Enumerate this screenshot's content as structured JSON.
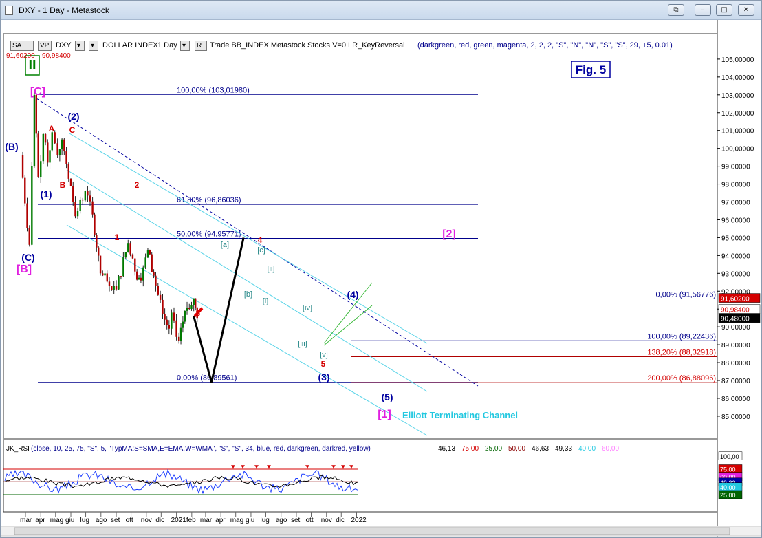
{
  "window": {
    "title": "DXY - 1 Day - Metastock",
    "buttons": {
      "restore_alt": "⧉",
      "minimize": "–",
      "maximize": "□",
      "close": "✕"
    }
  },
  "toolbar": {
    "sa_label": "SA",
    "vp_label": "VP",
    "symbol": "DXY",
    "symbol_name": "DOLLAR INDEX",
    "period": "1 Day",
    "r_label": "R",
    "expert_text": "Trade BB_INDEX Metastock Stocks V=0 LR_KeyReversal",
    "expert_params": "(darkgreen, red, green, magenta, 2, 2, 2, \"S\", \"N\", \"N\", \"S\", \"S\", 29, +5, 0.01)",
    "price_a": "91,60200",
    "price_b": "90,98400"
  },
  "colors": {
    "price_up": "#007a00",
    "price_down": "#b00000",
    "fib": "#00008b",
    "channel": "#5ad4e8",
    "red_label": "#d40000",
    "navy_label": "#0000a0",
    "magenta": "#e020e0",
    "teal": "#2a8a8a",
    "cyan_text": "#22c8e0",
    "green": "#008000"
  },
  "fig_label": "Fig. 5",
  "terminating_label": "Elliott Terminating Channel",
  "wave_labels": [
    {
      "text": "II",
      "kind": "green-box"
    },
    {
      "text": "[C]",
      "kind": "magenta"
    },
    {
      "text": "(B)",
      "kind": "navy"
    },
    {
      "text": "(1)",
      "kind": "navy"
    },
    {
      "text": "(2)",
      "kind": "navy"
    },
    {
      "text": "A",
      "kind": "red"
    },
    {
      "text": "B",
      "kind": "red"
    },
    {
      "text": "C",
      "kind": "red"
    },
    {
      "text": "(C)",
      "kind": "navy"
    },
    {
      "text": "[B]",
      "kind": "magenta"
    },
    {
      "text": "2",
      "kind": "red"
    },
    {
      "text": "1",
      "kind": "red"
    },
    {
      "text": "3",
      "kind": "red"
    },
    {
      "text": "4",
      "kind": "red"
    },
    {
      "text": "[a]",
      "kind": "teal"
    },
    {
      "text": "[b]",
      "kind": "teal"
    },
    {
      "text": "[c]",
      "kind": "teal"
    },
    {
      "text": "[i]",
      "kind": "teal"
    },
    {
      "text": "[ii]",
      "kind": "teal"
    },
    {
      "text": "[iii]",
      "kind": "teal"
    },
    {
      "text": "[iv]",
      "kind": "teal"
    },
    {
      "text": "[v]",
      "kind": "teal"
    },
    {
      "text": "5",
      "kind": "red"
    },
    {
      "text": "(3)",
      "kind": "navy"
    },
    {
      "text": "(4)",
      "kind": "navy"
    },
    {
      "text": "(5)",
      "kind": "navy"
    },
    {
      "text": "[1]",
      "kind": "magenta"
    },
    {
      "text": "[2]",
      "kind": "magenta"
    }
  ],
  "fib_levels": [
    {
      "label": "100,00% (103,01980)",
      "value": 103.0198,
      "side": "left"
    },
    {
      "label": "61,80% (96,86036)",
      "value": 96.86036,
      "side": "left"
    },
    {
      "label": "50,00% (94,95771)",
      "value": 94.95771,
      "side": "left"
    },
    {
      "label": "0,00% (86,89561)",
      "value": 86.89561,
      "side": "left"
    },
    {
      "label": "0,00% (91,56776)",
      "value": 91.56776,
      "side": "right"
    },
    {
      "label": "100,00% (89,22436)",
      "value": 89.22436,
      "side": "right"
    },
    {
      "label": "138,20% (88,32918)",
      "value": 88.32918,
      "side": "right"
    },
    {
      "label": "200,00% (86,88096)",
      "value": 86.88096,
      "side": "right"
    }
  ],
  "price_tags": [
    {
      "text": "91,60200",
      "value": 91.602,
      "bg": "#d40000",
      "fg": "#ffffff"
    },
    {
      "text": "90,98400",
      "value": 90.984,
      "bg": "#ffffff",
      "fg": "#d40000"
    },
    {
      "text": "90,48000",
      "value": 90.48,
      "bg": "#000000",
      "fg": "#ffffff"
    }
  ],
  "chart_data": {
    "type": "candlestick",
    "symbol": "DXY",
    "x_ticks": [
      "mar",
      "apr",
      "mag",
      "giu",
      "lug",
      "ago",
      "set",
      "ott",
      "nov",
      "dic",
      "2021",
      "feb",
      "mar",
      "apr",
      "mag",
      "giu",
      "lug",
      "ago",
      "set",
      "ott",
      "nov",
      "dic",
      "2022"
    ],
    "y_ticks": [
      "105,00000",
      "104,00000",
      "103,00000",
      "102,00000",
      "101,00000",
      "100,00000",
      "99,00000",
      "98,00000",
      "97,00000",
      "96,00000",
      "95,00000",
      "94,00000",
      "93,00000",
      "92,00000",
      "91,00000",
      "90,00000",
      "89,00000",
      "88,00000",
      "87,00000",
      "86,00000",
      "85,00000"
    ],
    "ylim": [
      84.5,
      106.0
    ],
    "price_path": [
      {
        "date": "2020-02-20",
        "close": 99.6
      },
      {
        "date": "2020-03-09",
        "close": 94.6
      },
      {
        "date": "2020-03-19",
        "close": 103.0
      },
      {
        "date": "2020-03-27",
        "close": 98.4
      },
      {
        "date": "2020-04-06",
        "close": 100.8
      },
      {
        "date": "2020-04-15",
        "close": 99.2
      },
      {
        "date": "2020-04-24",
        "close": 100.9
      },
      {
        "date": "2020-05-05",
        "close": 99.6
      },
      {
        "date": "2020-05-14",
        "close": 100.5
      },
      {
        "date": "2020-06-01",
        "close": 97.9
      },
      {
        "date": "2020-06-10",
        "close": 96.2
      },
      {
        "date": "2020-06-30",
        "close": 97.6
      },
      {
        "date": "2020-07-15",
        "close": 96.3
      },
      {
        "date": "2020-07-31",
        "close": 93.0
      },
      {
        "date": "2020-08-18",
        "close": 92.3
      },
      {
        "date": "2020-09-01",
        "close": 92.1
      },
      {
        "date": "2020-09-25",
        "close": 94.7
      },
      {
        "date": "2020-10-09",
        "close": 93.1
      },
      {
        "date": "2020-10-21",
        "close": 92.6
      },
      {
        "date": "2020-11-04",
        "close": 94.3
      },
      {
        "date": "2020-11-20",
        "close": 92.3
      },
      {
        "date": "2020-12-04",
        "close": 90.7
      },
      {
        "date": "2020-12-17",
        "close": 89.9
      },
      {
        "date": "2020-12-22",
        "close": 90.8
      },
      {
        "date": "2021-01-06",
        "close": 89.2
      },
      {
        "date": "2021-01-18",
        "close": 90.9
      },
      {
        "date": "2021-02-05",
        "close": 91.6
      },
      {
        "date": "2021-02-12",
        "close": 90.5
      }
    ],
    "projection": [
      {
        "date": "2021-02-05",
        "value": 91.6
      },
      {
        "date": "2021-03-13",
        "value": 86.9
      },
      {
        "date": "2021-05-17",
        "value": 95.0
      }
    ],
    "indicator": {
      "label": "JK_RSI",
      "params": "(close, 10, 25, 75, \"S\", 5, \"TypMA:S=SMA,E=EMA,W=WMA\", \"S\", \"S\", 34, blue, red, darkgreen, darkred, yellow)",
      "values": [
        {
          "text": "46,13",
          "color": "#000000"
        },
        {
          "text": "75,00",
          "color": "#d40000"
        },
        {
          "text": "25,00",
          "color": "#006400"
        },
        {
          "text": "50,00",
          "color": "#8b0000"
        },
        {
          "text": "46,63",
          "color": "#000000"
        },
        {
          "text": "49,33",
          "color": "#000000"
        },
        {
          "text": "40,00",
          "color": "#22c8e0"
        },
        {
          "text": "60,00",
          "color": "#ff80ff"
        }
      ],
      "levels": [
        {
          "text": "100,00",
          "value": 100,
          "bg": "#ffffff",
          "fg": "#000000"
        },
        {
          "text": "75,00",
          "value": 75,
          "bg": "#d40000",
          "fg": "#ffffff"
        },
        {
          "text": "60,00",
          "value": 60,
          "bg": "#e020e0",
          "fg": "#ffffff"
        },
        {
          "text": "49,33",
          "value": 49.33,
          "bg": "#0000a0",
          "fg": "#ffffff"
        },
        {
          "text": "40,00",
          "value": 40,
          "bg": "#22c8e0",
          "fg": "#ffffff"
        },
        {
          "text": "25,00",
          "value": 25,
          "bg": "#006400",
          "fg": "#ffffff"
        }
      ]
    }
  }
}
